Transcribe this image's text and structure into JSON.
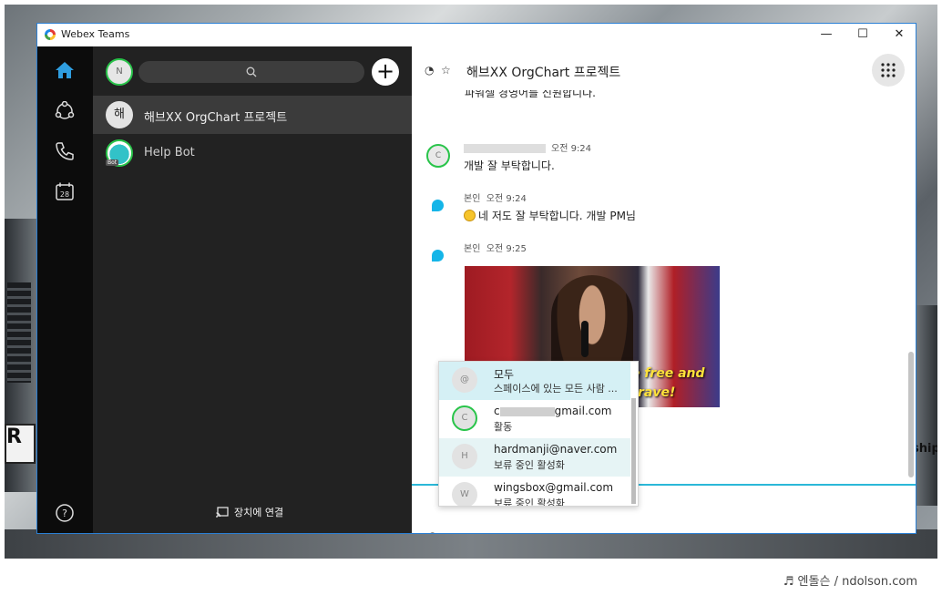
{
  "window": {
    "app_title": "Webex Teams"
  },
  "nav": {
    "calendar_day": "28"
  },
  "sidebar": {
    "user_initial": "N",
    "spaces": [
      {
        "initial": "해",
        "name": "해브XX OrgChart 프로젝트"
      },
      {
        "initial": "",
        "name": "Help Bot",
        "badge": "Bot"
      }
    ],
    "connect_label": "장치에 연결"
  },
  "space": {
    "title": "해브XX OrgChart 프로젝트",
    "partial_top_text": "파워셀 경영어를 신원합니다.",
    "messages": [
      {
        "avatar": "C",
        "time": "오전 9:24",
        "text": "개발 잘 부탁합니다."
      },
      {
        "sender": "본인",
        "time": "오전 9:24",
        "text": "네 저도 잘 부탁합니다. 개발 PM님"
      },
      {
        "sender": "본인",
        "time": "오전 9:25"
      }
    ],
    "gif_caption_1": "O'er the land of the free and",
    "gif_caption_2": "rave!",
    "composer_text": "@"
  },
  "mention_list": [
    {
      "avatar": "@",
      "name": "모두",
      "sub": "스페이스에 있는 모든 사람 ..."
    },
    {
      "avatar": "C",
      "name_prefix": "c",
      "name_suffix": "gmail.com",
      "sub": "활동"
    },
    {
      "avatar": "H",
      "name": "hardmanji@naver.com",
      "sub": "보류 중인 활성화"
    },
    {
      "avatar": "W",
      "name": "wingsbox@gmail.com",
      "sub": "보류 중인 활성화"
    }
  ],
  "credit": "♬ 엔돌슨 / ndolson.com"
}
